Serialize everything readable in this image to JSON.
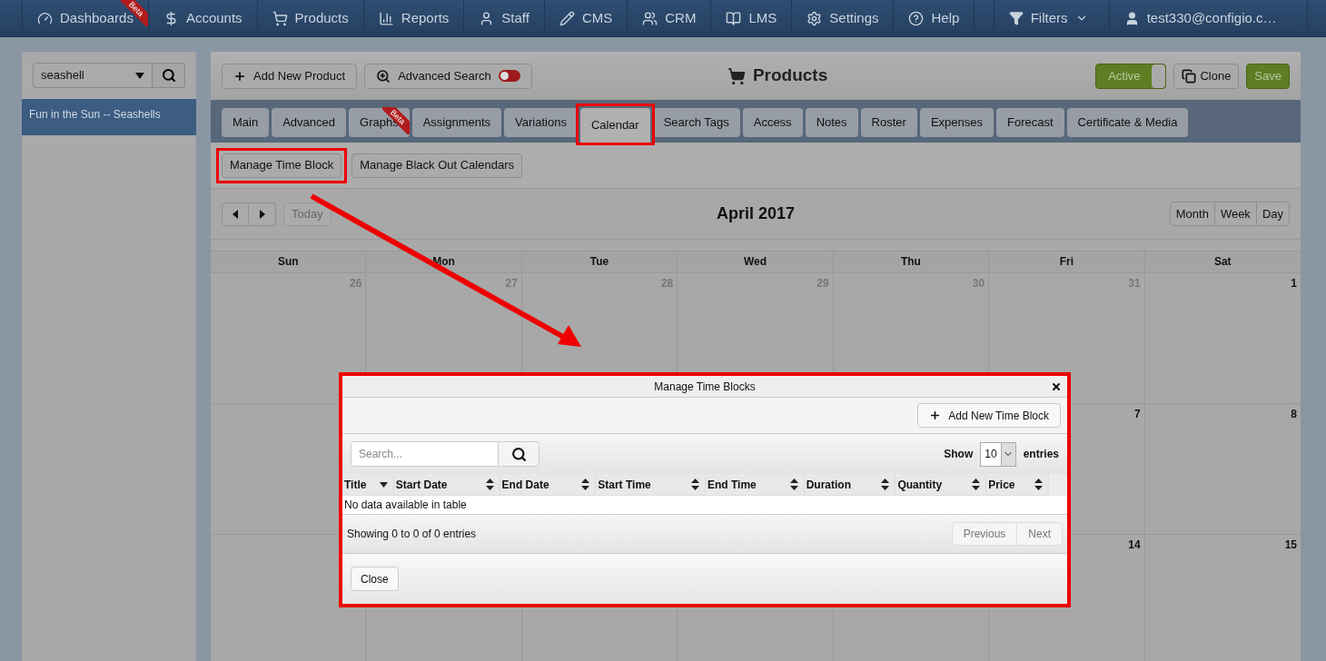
{
  "nav": {
    "items": [
      {
        "label": "Dashboards",
        "beta": "Beta"
      },
      {
        "label": "Accounts"
      },
      {
        "label": "Products"
      },
      {
        "label": "Reports"
      },
      {
        "label": "Staff"
      },
      {
        "label": "CMS"
      },
      {
        "label": "CRM"
      },
      {
        "label": "LMS"
      },
      {
        "label": "Settings"
      },
      {
        "label": "Help"
      }
    ],
    "filters": "Filters",
    "user": "test330@configio.c…"
  },
  "sidebar": {
    "search_value": "seashell",
    "items": [
      {
        "label": "Fun in the Sun -- Seashells",
        "selected": true
      }
    ]
  },
  "header": {
    "add_button": "Add New Product",
    "advanced_search": {
      "label": "Advanced Search",
      "on": false
    },
    "title": "Products",
    "active_toggle": {
      "label": "Active",
      "on": true
    },
    "clone": "Clone",
    "save": "Save"
  },
  "tabs": [
    {
      "label": "Main",
      "selected": false
    },
    {
      "label": "Advanced",
      "selected": false
    },
    {
      "label": "Graphs",
      "selected": false,
      "beta": "Beta"
    },
    {
      "label": "Assignments",
      "selected": false
    },
    {
      "label": "Variations",
      "selected": false
    },
    {
      "label": "Calendar",
      "selected": true,
      "highlighted": true
    },
    {
      "label": "Search Tags",
      "selected": false
    },
    {
      "label": "Access",
      "selected": false
    },
    {
      "label": "Notes",
      "selected": false
    },
    {
      "label": "Roster",
      "selected": false
    },
    {
      "label": "Expenses",
      "selected": false
    },
    {
      "label": "Forecast",
      "selected": false
    },
    {
      "label": "Certificate & Media",
      "selected": false
    }
  ],
  "subtabs": [
    {
      "label": "Manage Time Block",
      "highlighted": true
    },
    {
      "label": "Manage Black Out Calendars"
    }
  ],
  "calendar": {
    "today": "Today",
    "title": "April 2017",
    "views": [
      "Month",
      "Week",
      "Day"
    ],
    "days": [
      "Sun",
      "Mon",
      "Tue",
      "Wed",
      "Thu",
      "Fri",
      "Sat"
    ],
    "weeks": [
      {
        "sun": {
          "day": "26",
          "other_month": true
        },
        "mon": {
          "day": "27",
          "other_month": true
        },
        "tue": {
          "day": "28",
          "other_month": true
        },
        "wed": {
          "day": "29",
          "other_month": true
        },
        "thu": {
          "day": "30",
          "other_month": true
        },
        "fri": {
          "day": "31",
          "other_month": true
        },
        "sat": {
          "day": "1",
          "other_month": false
        }
      },
      {
        "fri": {
          "day": "7",
          "other_month": false
        },
        "sat": {
          "day": "8",
          "other_month": false
        }
      },
      {
        "fri": {
          "day": "14",
          "other_month": false
        },
        "sat": {
          "day": "15",
          "other_month": false
        }
      }
    ]
  },
  "modal": {
    "title": "Manage Time Blocks",
    "add_button": "Add New Time Block",
    "search_placeholder": "Search...",
    "show_label": "Show",
    "page_size": "10",
    "entries_label": "entries",
    "columns": [
      {
        "label": "Title",
        "sorted": true
      },
      {
        "label": "Start Date",
        "sorted": false
      },
      {
        "label": "End Date",
        "sorted": false
      },
      {
        "label": "Start Time",
        "sorted": false
      },
      {
        "label": "End Time",
        "sorted": false
      },
      {
        "label": "Duration",
        "sorted": false
      },
      {
        "label": "Quantity",
        "sorted": false
      },
      {
        "label": "Price",
        "sorted": false
      }
    ],
    "empty_message": "No data available in table",
    "info": "Showing 0 to 0 of 0 entries",
    "pager": [
      {
        "label": "Previous",
        "disabled": true
      },
      {
        "label": "Next",
        "disabled": true
      }
    ],
    "close": "Close"
  }
}
